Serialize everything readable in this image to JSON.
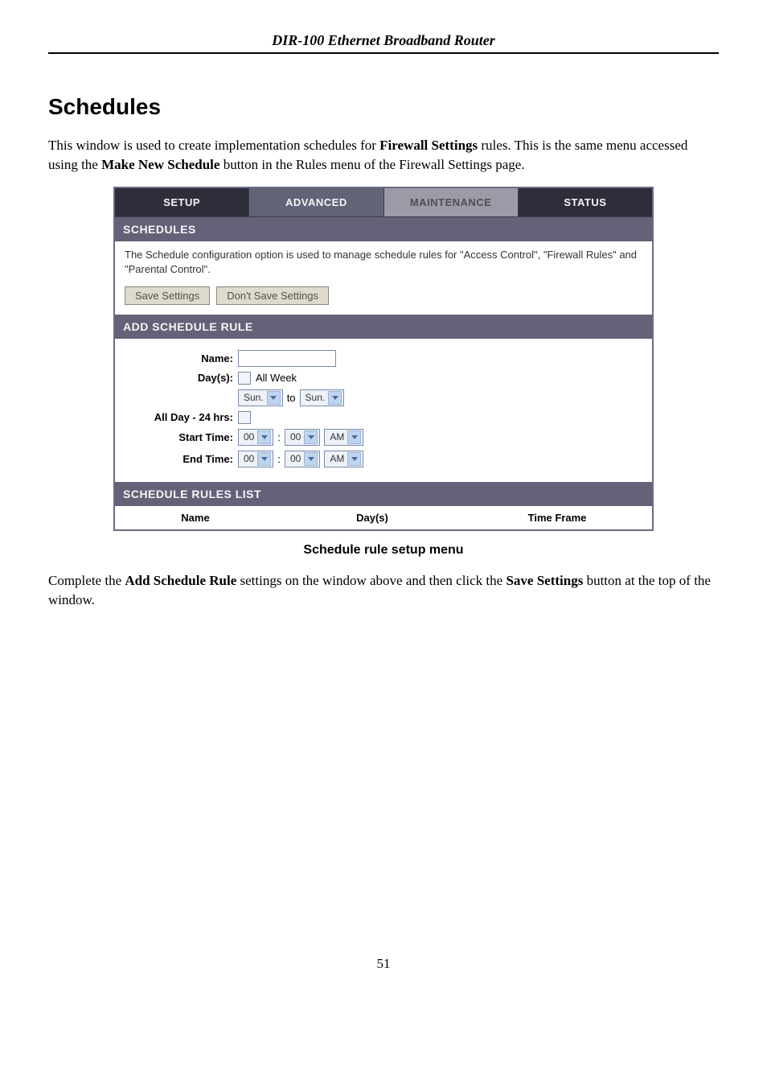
{
  "header": {
    "title": "DIR-100 Ethernet Broadband Router"
  },
  "section": {
    "heading": "Schedules"
  },
  "intro": {
    "seg1": "This window is used to create implementation schedules for ",
    "bold1": "Firewall Settings",
    "seg2": " rules. This is the same menu accessed using the ",
    "bold2": "Make New Schedule",
    "seg3": " button in the Rules menu of the Firewall Settings page."
  },
  "tabs": {
    "setup": "SETUP",
    "advanced": "ADVANCED",
    "maintenance": "MAINTENANCE",
    "status": "STATUS"
  },
  "schedules_panel": {
    "title": "SCHEDULES",
    "description": "The Schedule configuration option is used to manage schedule rules for \"Access Control\", \"Firewall Rules\" and \"Parental Control\".",
    "save_button": "Save Settings",
    "dont_save_button": "Don't Save Settings"
  },
  "add_rule_panel": {
    "title": "ADD SCHEDULE RULE",
    "labels": {
      "name": "Name:",
      "days": "Day(s):",
      "all_week": "All Week",
      "to": "to",
      "all_day": "All Day - 24 hrs:",
      "start_time": "Start Time:",
      "end_time": "End Time:",
      "colon": ":"
    },
    "selects": {
      "day_from": "Sun.",
      "day_to": "Sun.",
      "hour": "00",
      "minute": "00",
      "ampm": "AM"
    }
  },
  "rules_list_panel": {
    "title": "SCHEDULE RULES LIST",
    "columns": {
      "name": "Name",
      "days": "Day(s)",
      "time": "Time Frame"
    }
  },
  "caption": "Schedule rule setup menu",
  "outro": {
    "seg1": "Complete the ",
    "bold1": "Add Schedule Rule",
    "seg2": " settings on the window above and then click the ",
    "bold2": "Save Settings",
    "seg3": " button at the top of the window."
  },
  "page_num": "51"
}
